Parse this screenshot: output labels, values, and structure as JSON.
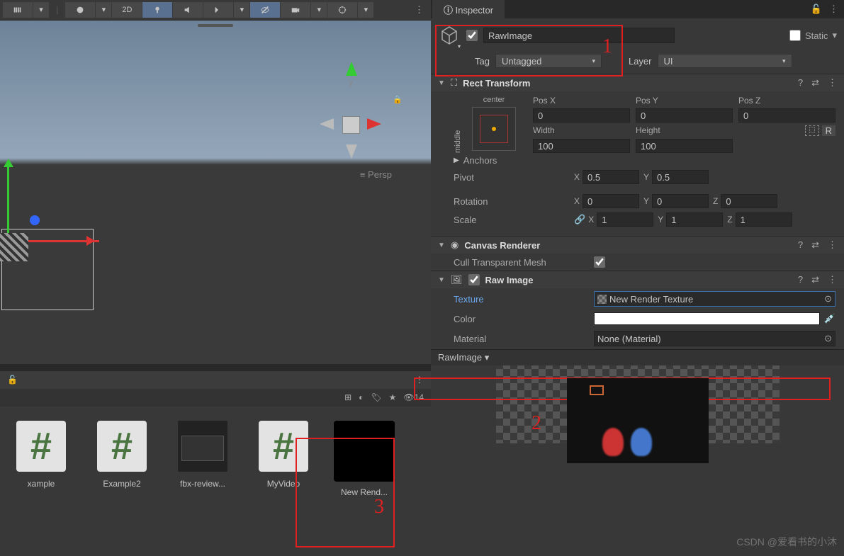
{
  "inspector": {
    "tab": "Inspector",
    "object_name": "RawImage",
    "enabled": true,
    "static_label": "Static",
    "tag_label": "Tag",
    "tag_value": "Untagged",
    "layer_label": "Layer",
    "layer_value": "UI"
  },
  "rect_transform": {
    "title": "Rect Transform",
    "anchor_h": "center",
    "anchor_v": "middle",
    "pos_x_label": "Pos X",
    "pos_x": "0",
    "pos_y_label": "Pos Y",
    "pos_y": "0",
    "pos_z_label": "Pos Z",
    "pos_z": "0",
    "width_label": "Width",
    "width": "100",
    "height_label": "Height",
    "height": "100",
    "anchors_label": "Anchors",
    "pivot_label": "Pivot",
    "pivot_x": "0.5",
    "pivot_y": "0.5",
    "rotation_label": "Rotation",
    "rot_x": "0",
    "rot_y": "0",
    "rot_z": "0",
    "scale_label": "Scale",
    "scale_x": "1",
    "scale_y": "1",
    "scale_z": "1"
  },
  "canvas_renderer": {
    "title": "Canvas Renderer",
    "cull_label": "Cull Transparent Mesh",
    "cull_value": true
  },
  "raw_image": {
    "title": "Raw Image",
    "texture_label": "Texture",
    "texture_value": "New Render Texture",
    "color_label": "Color",
    "material_label": "Material",
    "material_value": "None (Material)"
  },
  "preview": {
    "title": "RawImage"
  },
  "scene": {
    "mode_2d": "2D",
    "persp": "Persp",
    "gizmo_y": "y",
    "visible_count": "14"
  },
  "assets": [
    {
      "name": "xample",
      "type": "hash"
    },
    {
      "name": "Example2",
      "type": "hash"
    },
    {
      "name": "fbx-review...",
      "type": "dark"
    },
    {
      "name": "MyVideo",
      "type": "hash"
    },
    {
      "name": "New Rend...",
      "type": "black"
    }
  ],
  "annotations": {
    "box1": "1",
    "box2": "2",
    "box3": "3"
  },
  "watermark": "CSDN @爱看书的小沐"
}
